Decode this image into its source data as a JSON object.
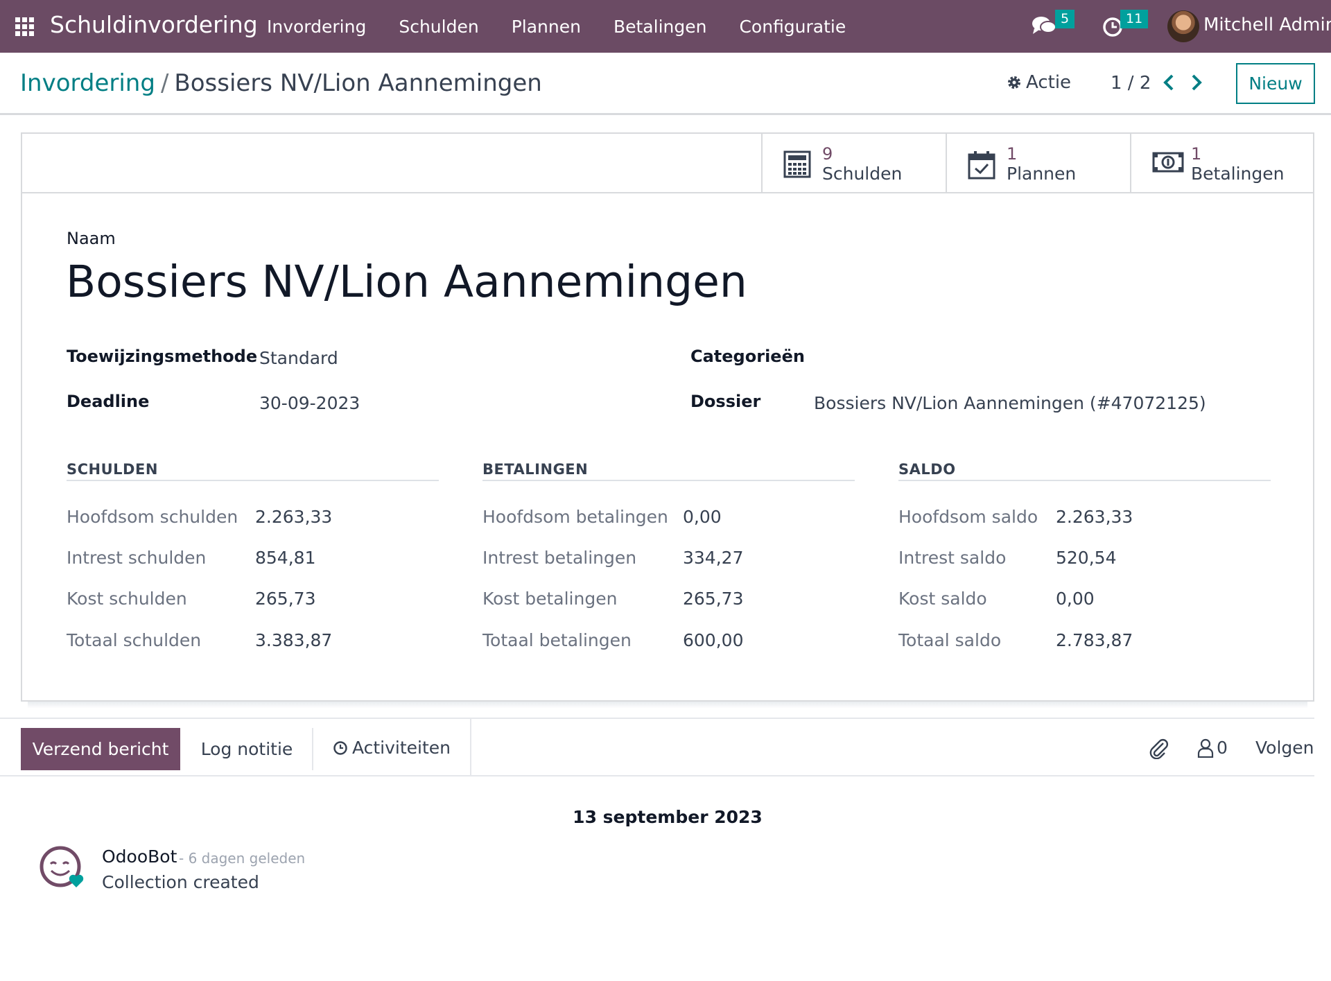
{
  "navbar": {
    "brand": "Schuldinvordering",
    "menu": [
      "Invordering",
      "Schulden",
      "Plannen",
      "Betalingen",
      "Configuratie"
    ],
    "messages_count": "5",
    "activities_count": "11",
    "user_name": "Mitchell Admin"
  },
  "control_panel": {
    "breadcrumb_parent": "Invordering",
    "breadcrumb_separator": "/",
    "breadcrumb_current": "Bossiers NV/Lion Aannemingen",
    "action_label": "Actie",
    "pager": "1 / 2",
    "new_button": "Nieuw"
  },
  "smart_buttons": [
    {
      "value": "9",
      "label": "Schulden",
      "icon": "calculator-icon"
    },
    {
      "value": "1",
      "label": "Plannen",
      "icon": "calendar-check-icon"
    },
    {
      "value": "1",
      "label": "Betalingen",
      "icon": "money-icon"
    }
  ],
  "form": {
    "name_label": "Naam",
    "name": "Bossiers NV/Lion Aannemingen",
    "fields": {
      "toewijzing_label": "Toewijzingsmethode",
      "toewijzing_value": "Standard",
      "deadline_label": "Deadline",
      "deadline_value": "30-09-2023",
      "categorieen_label": "Categorieën",
      "dossier_label": "Dossier",
      "dossier_value": "Bossiers NV/Lion Aannemingen (#47072125)"
    },
    "groups": [
      {
        "title": "SCHULDEN",
        "rows": [
          {
            "label": "Hoofdsom schulden",
            "value": "2.263,33"
          },
          {
            "label": "Intrest schulden",
            "value": "854,81"
          },
          {
            "label": "Kost schulden",
            "value": "265,73"
          },
          {
            "label": "Totaal schulden",
            "value": "3.383,87"
          }
        ]
      },
      {
        "title": "BETALINGEN",
        "rows": [
          {
            "label": "Hoofdsom betalingen",
            "value": "0,00"
          },
          {
            "label": "Intrest betalingen",
            "value": "334,27"
          },
          {
            "label": "Kost betalingen",
            "value": "265,73"
          },
          {
            "label": "Totaal betalingen",
            "value": "600,00"
          }
        ]
      },
      {
        "title": "SALDO",
        "rows": [
          {
            "label": "Hoofdsom saldo",
            "value": "2.263,33"
          },
          {
            "label": "Intrest saldo",
            "value": "520,54"
          },
          {
            "label": "Kost saldo",
            "value": "0,00"
          },
          {
            "label": "Totaal saldo",
            "value": "2.783,87"
          }
        ]
      }
    ]
  },
  "chatter": {
    "send_message": "Verzend bericht",
    "log_note": "Log notitie",
    "activities": "Activiteiten",
    "followers_count": "0",
    "follow": "Volgen",
    "date_separator": "13 september 2023",
    "message": {
      "author": "OdooBot",
      "meta": "- 6 dagen geleden",
      "body": "Collection created"
    }
  },
  "colors": {
    "navbar": "#6b4b64",
    "primary": "#714b67",
    "link": "#017e84",
    "badge": "#00a09d"
  }
}
